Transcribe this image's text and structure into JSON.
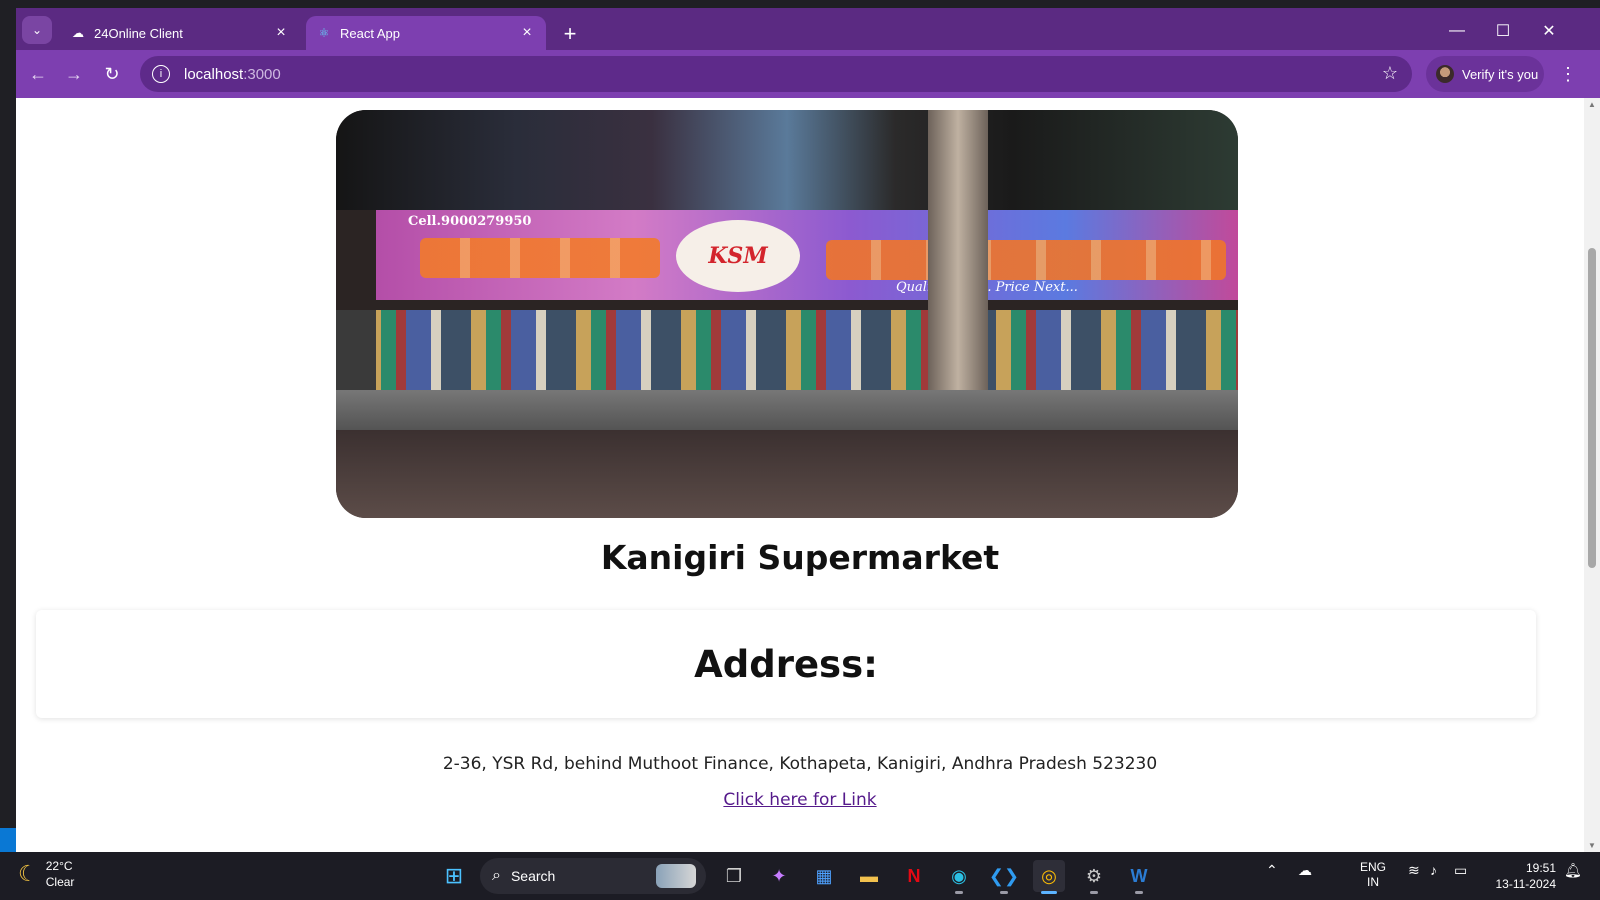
{
  "browser": {
    "tabs": [
      {
        "title": "24Online Client",
        "active": false,
        "favicon": "cloud-icon"
      },
      {
        "title": "React App",
        "active": true,
        "favicon": "react-icon"
      }
    ],
    "address_bar": {
      "host": "localhost",
      "path": ":3000"
    },
    "profile_label": "Verify it's you"
  },
  "page": {
    "store_name": "Kanigiri Supermarket",
    "address_heading": "Address:",
    "address": "2-36, YSR Rd, behind Muthoot Finance, Kothapeta, Kanigiri, Andhra Pradesh 523230",
    "link_text": "Click here for Link",
    "photo": {
      "phone_text": "Cell.9000279950",
      "logo_text": "KSM",
      "tagline": "Quality First... Price Next..."
    }
  },
  "taskbar": {
    "weather": {
      "temp": "22°C",
      "condition": "Clear"
    },
    "search_placeholder": "Search",
    "lang_primary": "ENG",
    "lang_region": "IN",
    "time": "19:51",
    "date": "13-11-2024"
  },
  "colors": {
    "tabbar": "#5b2a82",
    "toolbar": "#7d3fb0",
    "link": "#551a8b",
    "taskbar": "#1c1c24"
  }
}
